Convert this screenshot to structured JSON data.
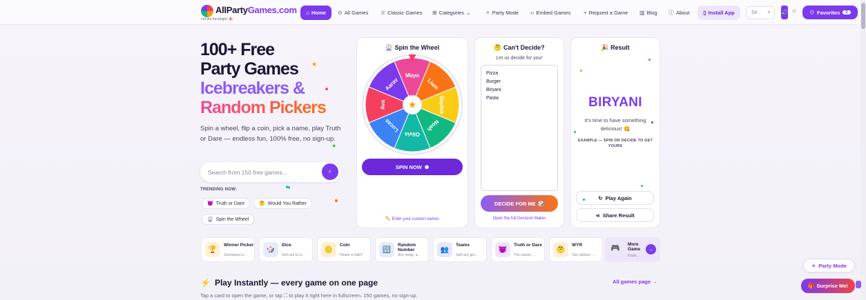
{
  "brand": {
    "name_part1": "AllParty",
    "name_part2": "Games.com",
    "tagline": "Let the fun begin! 🎉"
  },
  "nav": {
    "items": [
      {
        "label": "Home",
        "icon": "home-icon"
      },
      {
        "label": "All Games",
        "icon": "gamepad-icon"
      },
      {
        "label": "Classic Games",
        "icon": "trophy-icon"
      },
      {
        "label": "Categories",
        "icon": "grid-icon"
      },
      {
        "label": "Party Mode",
        "icon": "party-icon"
      },
      {
        "label": "Embed Games",
        "icon": "code-icon"
      },
      {
        "label": "Request a Game",
        "icon": "plus-icon"
      },
      {
        "label": "Blog",
        "icon": "book-icon"
      },
      {
        "label": "About",
        "icon": "info-icon"
      }
    ],
    "install_label": "Install App",
    "search_placeholder": "Se",
    "favorites_label": "Favorites",
    "favorites_count": "2"
  },
  "hero": {
    "line1": "100+ Free",
    "line2": "Party Games",
    "line3": "Icebreakers &",
    "line4": "Random Pickers",
    "subtitle": "Spin a wheel, flip a coin, pick a name, play Truth or Dare — endless fun, 100% free, no sign-up.",
    "search_placeholder": "Search from 150 free games...",
    "trending_label": "TRENDING NOW:",
    "trending": [
      {
        "label": "Truth or Dare",
        "icon": "😈"
      },
      {
        "label": "Would You Rather",
        "icon": "🤔"
      },
      {
        "label": "Spin the Wheel",
        "icon": "🎡"
      }
    ]
  },
  "wheel_card": {
    "title": "Spin the Wheel",
    "title_icon": "🎡",
    "segments": [
      {
        "name": "Maya",
        "color": "#ec4899"
      },
      {
        "name": "Liam",
        "color": "#f97316"
      },
      {
        "name": "Sophia",
        "color": "#facc15"
      },
      {
        "name": "Noah",
        "color": "#10b981"
      },
      {
        "name": "Olivia",
        "color": "#14b8a6"
      },
      {
        "name": "Lucas",
        "color": "#3b82f6"
      },
      {
        "name": "Ava",
        "color": "#f43f5e"
      },
      {
        "name": "Aarav",
        "color": "#7c3aed"
      }
    ],
    "spin_label": "SPIN NOW",
    "footer": "✏️ Enter your custom names"
  },
  "decide_card": {
    "title": "Can't Decide?",
    "title_icon": "🤔",
    "subtitle": "Let us decide for you!",
    "options": [
      "Pizza",
      "Burger",
      "Biryani",
      "Pasta"
    ],
    "button_label": "DECIDE FOR ME",
    "footer": "Open the full Decision Maker"
  },
  "result_card": {
    "title": "Result",
    "title_icon": "🎉",
    "value": "BIRYANI",
    "message": "It's time to have something delicious! 😋",
    "example_note": "EXAMPLE — SPIN OR DECIDE TO GET YOURS",
    "play_again": "Play Again",
    "share": "Share Result"
  },
  "game_strip": [
    {
      "name": "Winner Picker",
      "sub": "Giveaways a...",
      "icon": "🏆",
      "bg": "#fdf3d3"
    },
    {
      "name": "Dice",
      "sub": "Roll one to si...",
      "icon": "🎲",
      "bg": "#e8eafc"
    },
    {
      "name": "Coin",
      "sub": "Heads or tails?",
      "icon": "🪙",
      "bg": "#fdf0d0"
    },
    {
      "name": "Random Number",
      "sub": "Any range, a...",
      "icon": "🔢",
      "bg": "#e3ecfb"
    },
    {
      "name": "Teams",
      "sub": "Split any gro...",
      "icon": "👥",
      "bg": "#e9e6fa"
    },
    {
      "name": "Truth or Dare",
      "sub": "The classic, ...",
      "icon": "😈",
      "bg": "#efe4fb"
    },
    {
      "name": "WYR",
      "sub": "Two options. ...",
      "icon": "🤔",
      "bg": "#fdf0d8"
    }
  ],
  "more_tile": {
    "name": "More Game",
    "sub": "Explo...",
    "icon": "🎮"
  },
  "play_section": {
    "title": "Play Instantly — every game on one page",
    "subtitle": "Tap a card to open the game, or tap ⛶ to play it right here in fullscreen. 150 games, no sign-up.",
    "all_link": "All games page →"
  },
  "floating": {
    "party_mode": "Party Mode",
    "surprise": "Surprise Me!"
  }
}
